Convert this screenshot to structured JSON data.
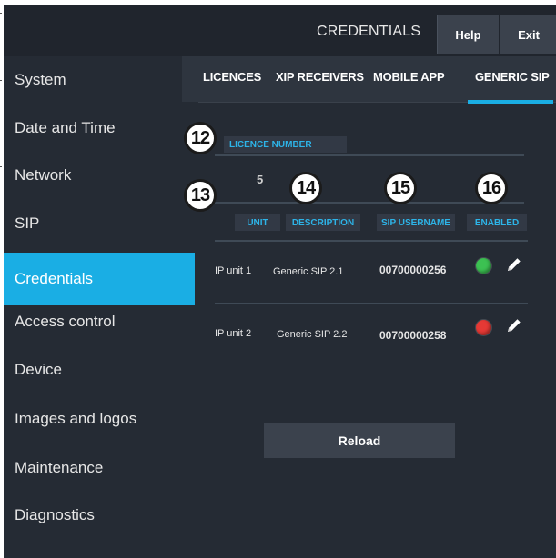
{
  "header": {
    "title": "CREDENTIALS",
    "help_label": "Help",
    "exit_label": "Exit"
  },
  "sidebar": {
    "items": [
      {
        "label": "System"
      },
      {
        "label": "Date and Time"
      },
      {
        "label": "Network"
      },
      {
        "label": "SIP"
      },
      {
        "label": "Credentials",
        "active": true
      },
      {
        "label": "Access control"
      },
      {
        "label": "Device"
      },
      {
        "label": "Images and logos"
      },
      {
        "label": "Maintenance"
      },
      {
        "label": "Diagnostics"
      }
    ]
  },
  "tabs": [
    {
      "label": "LICENCES"
    },
    {
      "label": "XIP RECEIVERS"
    },
    {
      "label": "MOBILE APP"
    },
    {
      "label": "GENERIC SIP",
      "active": true
    }
  ],
  "licence": {
    "header": "LICENCE NUMBER",
    "value": "5"
  },
  "table": {
    "columns": [
      "UNIT",
      "DESCRIPTION",
      "SIP USERNAME",
      "ENABLED"
    ],
    "rows": [
      {
        "unit": "IP unit 1",
        "description": "Generic SIP 2.1",
        "sip_username": "00700000256",
        "enabled": true
      },
      {
        "unit": "IP unit 2",
        "description": "Generic SIP 2.2",
        "sip_username": "00700000258",
        "enabled": false
      }
    ]
  },
  "reload_label": "Reload",
  "callouts": [
    "12",
    "13",
    "14",
    "15",
    "16"
  ],
  "colors": {
    "accent": "#1aaee4",
    "enabled_on": "#3cc152",
    "enabled_off": "#e53935",
    "background": "#252b34"
  },
  "icons": {
    "edit": "pencil-icon",
    "status": "status-dot-icon"
  }
}
